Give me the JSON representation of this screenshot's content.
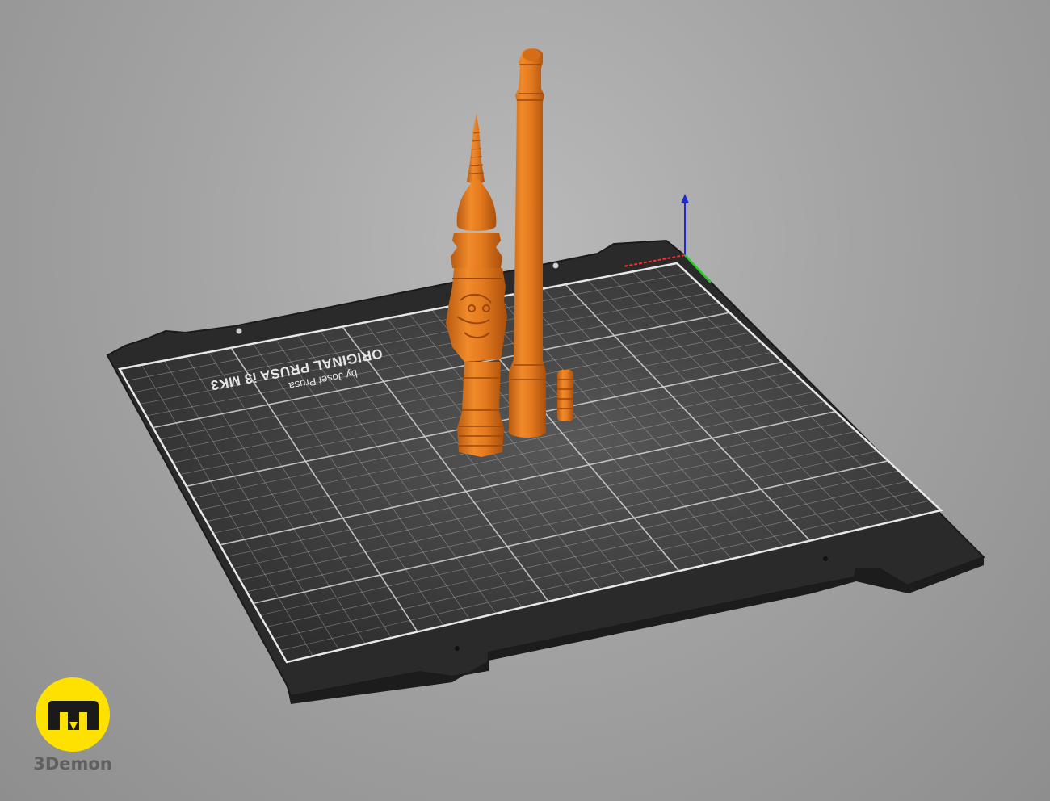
{
  "app": {
    "view": "3D plater view",
    "background_colors": [
      "#b9b9b9",
      "#8e8e8e"
    ]
  },
  "bed": {
    "print_line1": "ORIGINAL PRUSA i3 MK3",
    "print_line2": "by Josef Prusa",
    "sheet_color": "#2b2b2b",
    "grid_color": "#cfcfcf"
  },
  "axes": {
    "x_color": "#ff2a2a",
    "y_color": "#22cc22",
    "z_color": "#1d2bd6"
  },
  "models": [
    {
      "name": "staff-with-carved-figure",
      "color": "#e0761c"
    },
    {
      "name": "long-staff",
      "color": "#e0761c"
    },
    {
      "name": "small-cylinder-part",
      "color": "#e0761c"
    }
  ],
  "brand": {
    "name": "3Demon",
    "logo_color": "#ffe100",
    "logo_glyph_color": "#1a1a1a"
  }
}
